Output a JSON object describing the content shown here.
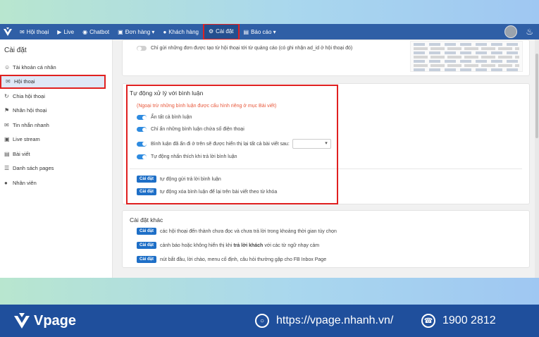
{
  "nav": {
    "items": [
      {
        "label": "Hội thoại",
        "icon": "chat-icon"
      },
      {
        "label": "Live",
        "icon": "video-icon"
      },
      {
        "label": "Chatbot",
        "icon": "robot-icon"
      },
      {
        "label": "Đơn hàng ▾",
        "icon": "cart-icon"
      },
      {
        "label": "Khách hàng",
        "icon": "users-icon"
      },
      {
        "label": "Cài đặt",
        "icon": "gear-icon"
      },
      {
        "label": "Báo cáo ▾",
        "icon": "chart-icon"
      }
    ]
  },
  "sidebar": {
    "title": "Cài đặt",
    "items": [
      {
        "label": "Tài khoản cá nhân"
      },
      {
        "label": "Hội thoại"
      },
      {
        "label": "Chia hội thoại"
      },
      {
        "label": "Nhãn hội thoại"
      },
      {
        "label": "Tin nhắn nhanh"
      },
      {
        "label": "Live stream"
      },
      {
        "label": "Bài viết"
      },
      {
        "label": "Danh sách pages"
      },
      {
        "label": "Nhân viên"
      }
    ]
  },
  "card1": {
    "option": "Chỉ gửi những đơn được tạo từ hội thoại tới từ quảng cáo (có ghi nhận ad_id ở hội thoại đó)"
  },
  "comments": {
    "title": "Tự động xử lý với bình luận",
    "warning": "(Ngoại trừ những bình luận được cấu hình riêng ở mục Bài viết)",
    "toggles": [
      "Ẩn tất cả bình luận",
      "Chỉ ẩn những bình luận chứa số điện thoại",
      "Bình luận đã ẩn đi ở trên sẽ được hiển thị lại tất cả bài viết sau:",
      "Tự động nhấn thích khi trả lời bình luận"
    ],
    "button_label": "Cài đặt",
    "actions": [
      "tự động gửi trả lời bình luận",
      "tự động xóa bình luận để lại trên bài viết theo từ khóa"
    ]
  },
  "other": {
    "title": "Cài đặt khác",
    "button_label": "Cài đặt",
    "rows": [
      {
        "pre": "các hội thoại đến thành chưa đọc và chưa trả lời trong khoảng thời gian tùy chọn",
        "bold": "",
        "post": ""
      },
      {
        "pre": "cảnh báo hoặc không hiển thị khi ",
        "bold": "trả lời khách",
        "post": " với các từ ngữ nhạy cảm"
      },
      {
        "pre": "nút bắt đầu, lời chào, menu cố định, câu hỏi thường gặp cho FB Inbox Page",
        "bold": "",
        "post": ""
      }
    ]
  },
  "footer": {
    "brand": "Vpage",
    "website": "https://vpage.nhanh.vn/",
    "phone": "1900 2812"
  },
  "colors": {
    "nav_bg": "#2f5fa6",
    "accent": "#1e6fc7",
    "highlight": "#e02020",
    "footer_bg": "#1f4f9c"
  }
}
